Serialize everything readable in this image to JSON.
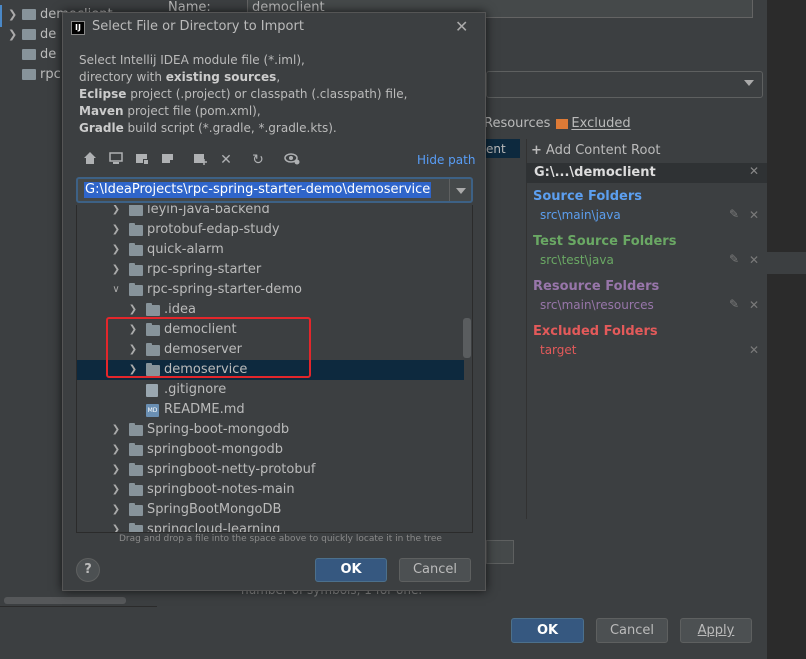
{
  "background": {
    "left_tree": [
      {
        "label": "democlient"
      },
      {
        "label": "de"
      },
      {
        "label": "de"
      },
      {
        "label": "rpc"
      }
    ],
    "name_label": "Name:",
    "name_value": "democlient",
    "tabs_text": "Resources",
    "excluded_tab": "Excluded",
    "list_selected": "ent",
    "add_content_root": "Add Content Root",
    "content_root_path": "G:\\...\\democlient",
    "source_folders": {
      "title": "Source Folders",
      "path": "src\\main\\java",
      "color": "#5c9ff0"
    },
    "test_source_folders": {
      "title": "Test Source Folders",
      "path": "src\\test\\java",
      "color": "#6aa864"
    },
    "resource_folders": {
      "title": "Resource Folders",
      "path": "src\\main\\resources",
      "color": "#9876aa"
    },
    "excluded_folders": {
      "title": "Excluded Folders",
      "path": "target",
      "color": "#e35a5a"
    },
    "hint_text": "number of symbols, 1 for one.",
    "ok_label": "OK",
    "cancel_label": "Cancel",
    "apply_label": "Apply"
  },
  "dialog": {
    "title": "Select File or Directory to Import",
    "close_icon": "close-icon",
    "description": {
      "line1": "Select Intellij IDEA module file (*.iml),",
      "line2_pre": "directory with ",
      "line2_bold": "existing sources",
      "line2_post": ",",
      "line3_bold": "Eclipse",
      "line3_post": " project (.project) or classpath (.classpath) file,",
      "line4_bold": "Maven",
      "line4_post": " project file (pom.xml),",
      "line5_bold": "Gradle",
      "line5_post": " build script (*.gradle, *.gradle.kts)."
    },
    "toolbar_icons": [
      "home-icon",
      "desktop-icon",
      "project-icon",
      "module-icon",
      "new-folder-icon",
      "delete-icon",
      "refresh-icon",
      "show-hidden-icon"
    ],
    "hide_path_label": "Hide path",
    "path_value": "G:\\IdeaProjects\\rpc-spring-starter-demo\\demoservice",
    "tree": [
      {
        "label": "leyin-java-backend",
        "level": 0,
        "expanded": false,
        "type": "folder"
      },
      {
        "label": "protobuf-edap-study",
        "level": 0,
        "expanded": false,
        "type": "folder"
      },
      {
        "label": "quick-alarm",
        "level": 0,
        "expanded": false,
        "type": "folder"
      },
      {
        "label": "rpc-spring-starter",
        "level": 0,
        "expanded": false,
        "type": "folder"
      },
      {
        "label": "rpc-spring-starter-demo",
        "level": 0,
        "expanded": true,
        "type": "folder"
      },
      {
        "label": ".idea",
        "level": 1,
        "expanded": false,
        "type": "folder"
      },
      {
        "label": "democlient",
        "level": 1,
        "expanded": false,
        "type": "folder"
      },
      {
        "label": "demoserver",
        "level": 1,
        "expanded": false,
        "type": "folder"
      },
      {
        "label": "demoservice",
        "level": 1,
        "expanded": false,
        "type": "folder",
        "selected": true
      },
      {
        "label": ".gitignore",
        "level": 1,
        "type": "file"
      },
      {
        "label": "README.md",
        "level": 1,
        "type": "md"
      },
      {
        "label": "Spring-boot-mongodb",
        "level": 0,
        "expanded": false,
        "type": "folder"
      },
      {
        "label": "springboot-mongodb",
        "level": 0,
        "expanded": false,
        "type": "folder"
      },
      {
        "label": "springboot-netty-protobuf",
        "level": 0,
        "expanded": false,
        "type": "folder"
      },
      {
        "label": "springboot-notes-main",
        "level": 0,
        "expanded": false,
        "type": "folder"
      },
      {
        "label": "SpringBootMongoDB",
        "level": 0,
        "expanded": false,
        "type": "folder"
      },
      {
        "label": "springcloud-learning",
        "level": 0,
        "expanded": false,
        "type": "folder"
      }
    ],
    "drag_hint": "Drag and drop a file into the space above to quickly locate it in the tree",
    "help_label": "?",
    "ok_label": "OK",
    "cancel_label": "Cancel"
  }
}
